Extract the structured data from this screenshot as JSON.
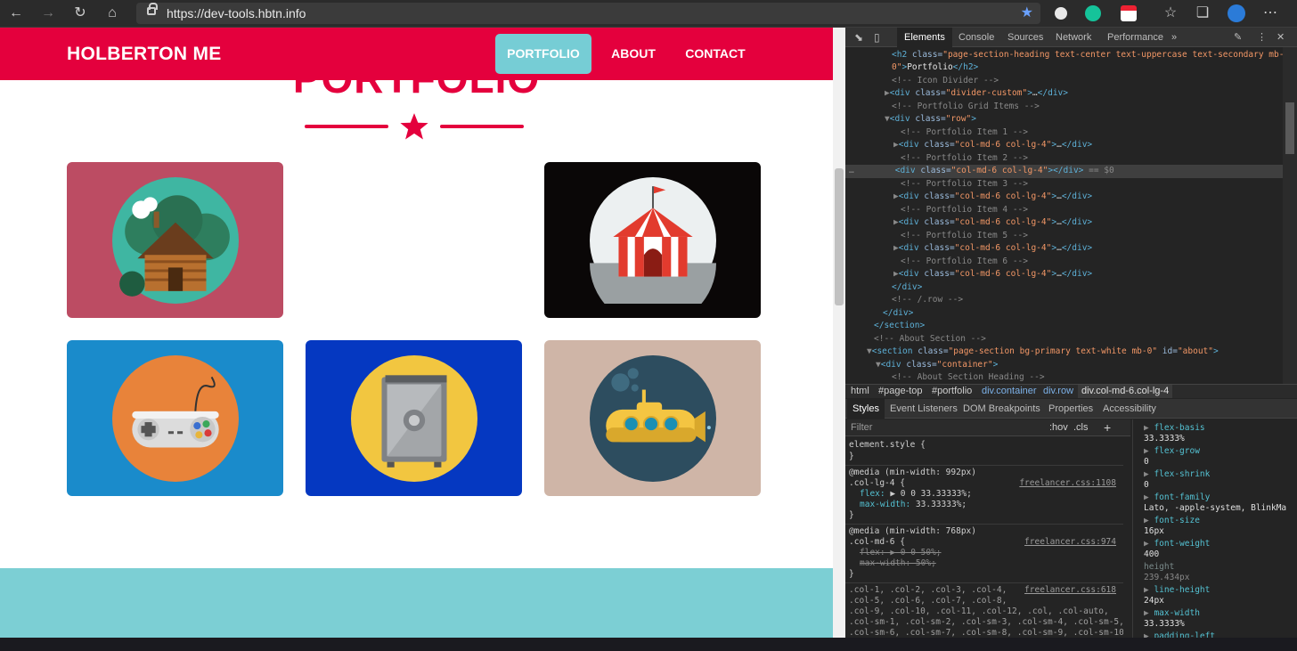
{
  "browser": {
    "url": "https://dev-tools.hbtn.info"
  },
  "page": {
    "brand": "HOLBERTON ME",
    "nav": [
      {
        "label": "PORTFOLIO",
        "active": true
      },
      {
        "label": "ABOUT",
        "active": false
      },
      {
        "label": "CONTACT",
        "active": false
      }
    ],
    "section_heading": "PORTFOLIO",
    "tiles": [
      {
        "name": "cabin",
        "bg": "#bc4c63",
        "circle": "#3fb6a2"
      },
      {
        "name": "circus-tent",
        "bg": "#0a0707",
        "circle": "#ecf0f1"
      },
      {
        "name": "game-controller",
        "bg": "#1a8bcb",
        "circle": "#e8833a"
      },
      {
        "name": "safe",
        "bg": "#0538c1",
        "circle": "#f2c640"
      },
      {
        "name": "submarine",
        "bg": "#cfb5a7",
        "circle": "#2d4d5f"
      }
    ],
    "colors": {
      "primary": "#e4003d",
      "secondary": "#76cdd5"
    }
  },
  "devtools": {
    "tabs": [
      "Elements",
      "Console",
      "Sources",
      "Network",
      "Performance"
    ],
    "active_tab": "Elements",
    "breadcrumbs": [
      "html",
      "#page-top",
      "#portfolio",
      "div.container",
      "div.row",
      "div.col-md-6.col-lg-4"
    ],
    "styles_tabs": [
      "Styles",
      "Event Listeners",
      "DOM Breakpoints",
      "Properties",
      "Accessibility"
    ],
    "filter_placeholder": "Filter",
    "filter_hov": ":hov",
    "filter_cls": ".cls",
    "selected_marker": "== $0",
    "computed": [
      {
        "name": "flex-basis",
        "value": "33.3333%",
        "dim": false
      },
      {
        "name": "flex-grow",
        "value": "0",
        "dim": false
      },
      {
        "name": "flex-shrink",
        "value": "0",
        "dim": false
      },
      {
        "name": "font-family",
        "value": "Lato, -apple-system, BlinkMa",
        "dim": false
      },
      {
        "name": "font-size",
        "value": "16px",
        "dim": false
      },
      {
        "name": "font-weight",
        "value": "400",
        "dim": false
      },
      {
        "name": "height",
        "value": "239.434px",
        "dim": true
      },
      {
        "name": "line-height",
        "value": "24px",
        "dim": false
      },
      {
        "name": "max-width",
        "value": "33.3333%",
        "dim": false
      },
      {
        "name": "padding-left",
        "value": "",
        "dim": false
      }
    ]
  }
}
